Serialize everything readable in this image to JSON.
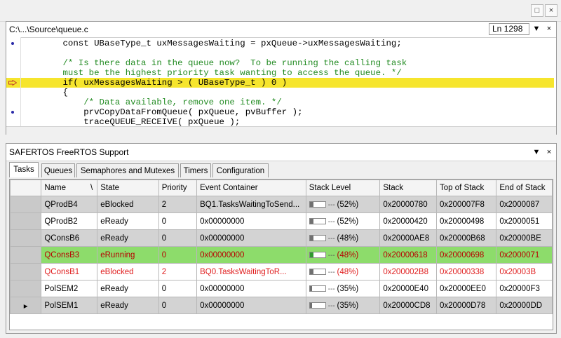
{
  "window": {
    "close_icon": "×",
    "maximize_icon": "□"
  },
  "editor": {
    "path": "C:\\...\\Source\\queue.c",
    "line_indicator": "Ln 1298",
    "code_lines": [
      {
        "text": "        const UBaseType_t uxMessagesWaiting = pxQueue->uxMessagesWaiting;",
        "marker": "dot"
      },
      {
        "text": "",
        "marker": ""
      },
      {
        "text": "        /* Is there data in the queue now?  To be running the calling task",
        "marker": ""
      },
      {
        "text": "        must be the highest priority task wanting to access the queue. */",
        "marker": ""
      },
      {
        "text": "        if( uxMessagesWaiting > ( UBaseType_t ) 0 )",
        "marker": "arrow"
      },
      {
        "text": "        {",
        "marker": ""
      },
      {
        "text": "            /* Data available, remove one item. */",
        "marker": ""
      },
      {
        "text": "            prvCopyDataFromQueue( pxQueue, pvBuffer );",
        "marker": "dot"
      },
      {
        "text": "            traceQUEUE_RECEIVE( pxQueue );",
        "marker": ""
      }
    ]
  },
  "panel": {
    "title": "SAFERTOS FreeRTOS Support",
    "tabs": [
      "Tasks",
      "Queues",
      "Semaphores and Mutexes",
      "Timers",
      "Configuration"
    ],
    "active_tab": "Tasks",
    "columns": [
      "",
      "Name",
      "State",
      "Priority",
      "Event Container",
      "Stack Level",
      "Stack",
      "Top of Stack",
      "End of Stack"
    ],
    "sort_indicator": "\\",
    "rows": [
      {
        "marker": "",
        "name": "QProdB4",
        "state": "eBlocked",
        "priority": "2",
        "event": "BQ1.TasksWaitingToSend...",
        "stack_level": "(52%)",
        "stack_fill": 0.52,
        "stack": "0x20000780",
        "top": "0x200007F8",
        "end": "0x2000087",
        "style": "even"
      },
      {
        "marker": "",
        "name": "QProdB2",
        "state": "eReady",
        "priority": "0",
        "event": "0x00000000",
        "stack_level": "(52%)",
        "stack_fill": 0.52,
        "stack": "0x20000420",
        "top": "0x20000498",
        "end": "0x2000051",
        "style": "odd"
      },
      {
        "marker": "",
        "name": "QConsB6",
        "state": "eReady",
        "priority": "0",
        "event": "0x00000000",
        "stack_level": "(48%)",
        "stack_fill": 0.48,
        "stack": "0x20000AE8",
        "top": "0x20000B68",
        "end": "0x20000BE",
        "style": "even"
      },
      {
        "marker": "",
        "name": "QConsB3",
        "state": "eRunning",
        "priority": "0",
        "event": "0x00000000",
        "stack_level": "(48%)",
        "stack_fill": 0.48,
        "stack": "0x20000618",
        "top": "0x20000698",
        "end": "0x2000071",
        "style": "run"
      },
      {
        "marker": "",
        "name": "QConsB1",
        "state": "eBlocked",
        "priority": "2",
        "event": "BQ0.TasksWaitingToR...",
        "stack_level": "(48%)",
        "stack_fill": 0.48,
        "stack": "0x200002B8",
        "top": "0x20000338",
        "end": "0x20003B",
        "style": "blk"
      },
      {
        "marker": "",
        "name": "PolSEM2",
        "state": "eReady",
        "priority": "0",
        "event": "0x00000000",
        "stack_level": "(35%)",
        "stack_fill": 0.35,
        "stack": "0x20000E40",
        "top": "0x20000EE0",
        "end": "0x20000F3",
        "style": "odd"
      },
      {
        "marker": "▸",
        "name": "PolSEM1",
        "state": "eReady",
        "priority": "0",
        "event": "0x00000000",
        "stack_level": "(35%)",
        "stack_fill": 0.35,
        "stack": "0x20000CD8",
        "top": "0x20000D78",
        "end": "0x20000DD",
        "style": "even"
      }
    ]
  },
  "icons": [
    "close-icon",
    "maximize-icon",
    "dropdown-icon",
    "breakpoint-dot-icon",
    "current-line-arrow-icon",
    "row-pointer-icon"
  ]
}
